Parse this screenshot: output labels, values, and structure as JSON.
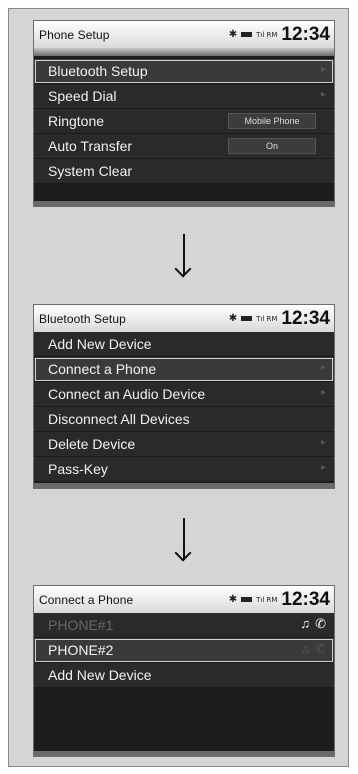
{
  "status": {
    "bluetooth_icon": "bluetooth-icon",
    "battery_icon": "battery-icon",
    "signal_text": "Tıl RM",
    "time": "12:34"
  },
  "screens": [
    {
      "title": "Phone Setup",
      "items": [
        {
          "label": "Bluetooth Setup",
          "selected": true
        },
        {
          "label": "Speed Dial"
        },
        {
          "label": "Ringtone",
          "value": "Mobile Phone"
        },
        {
          "label": "Auto Transfer",
          "value": "On"
        },
        {
          "label": "System Clear"
        }
      ]
    },
    {
      "title": "Bluetooth Setup",
      "items": [
        {
          "label": "Add New Device"
        },
        {
          "label": "Connect a Phone",
          "selected": true
        },
        {
          "label": "Connect an Audio Device"
        },
        {
          "label": "Disconnect All Devices"
        },
        {
          "label": "Delete Device"
        },
        {
          "label": "Pass-Key"
        }
      ]
    },
    {
      "title": "Connect a Phone",
      "items": [
        {
          "label": "PHONE#1",
          "icons": [
            "♫",
            "✆"
          ]
        },
        {
          "label": "PHONE#2",
          "selected": true,
          "icons": [
            "♫",
            "✆"
          ]
        },
        {
          "label": "Add New Device"
        }
      ]
    }
  ],
  "arrow_icon": "arrow-down-icon"
}
